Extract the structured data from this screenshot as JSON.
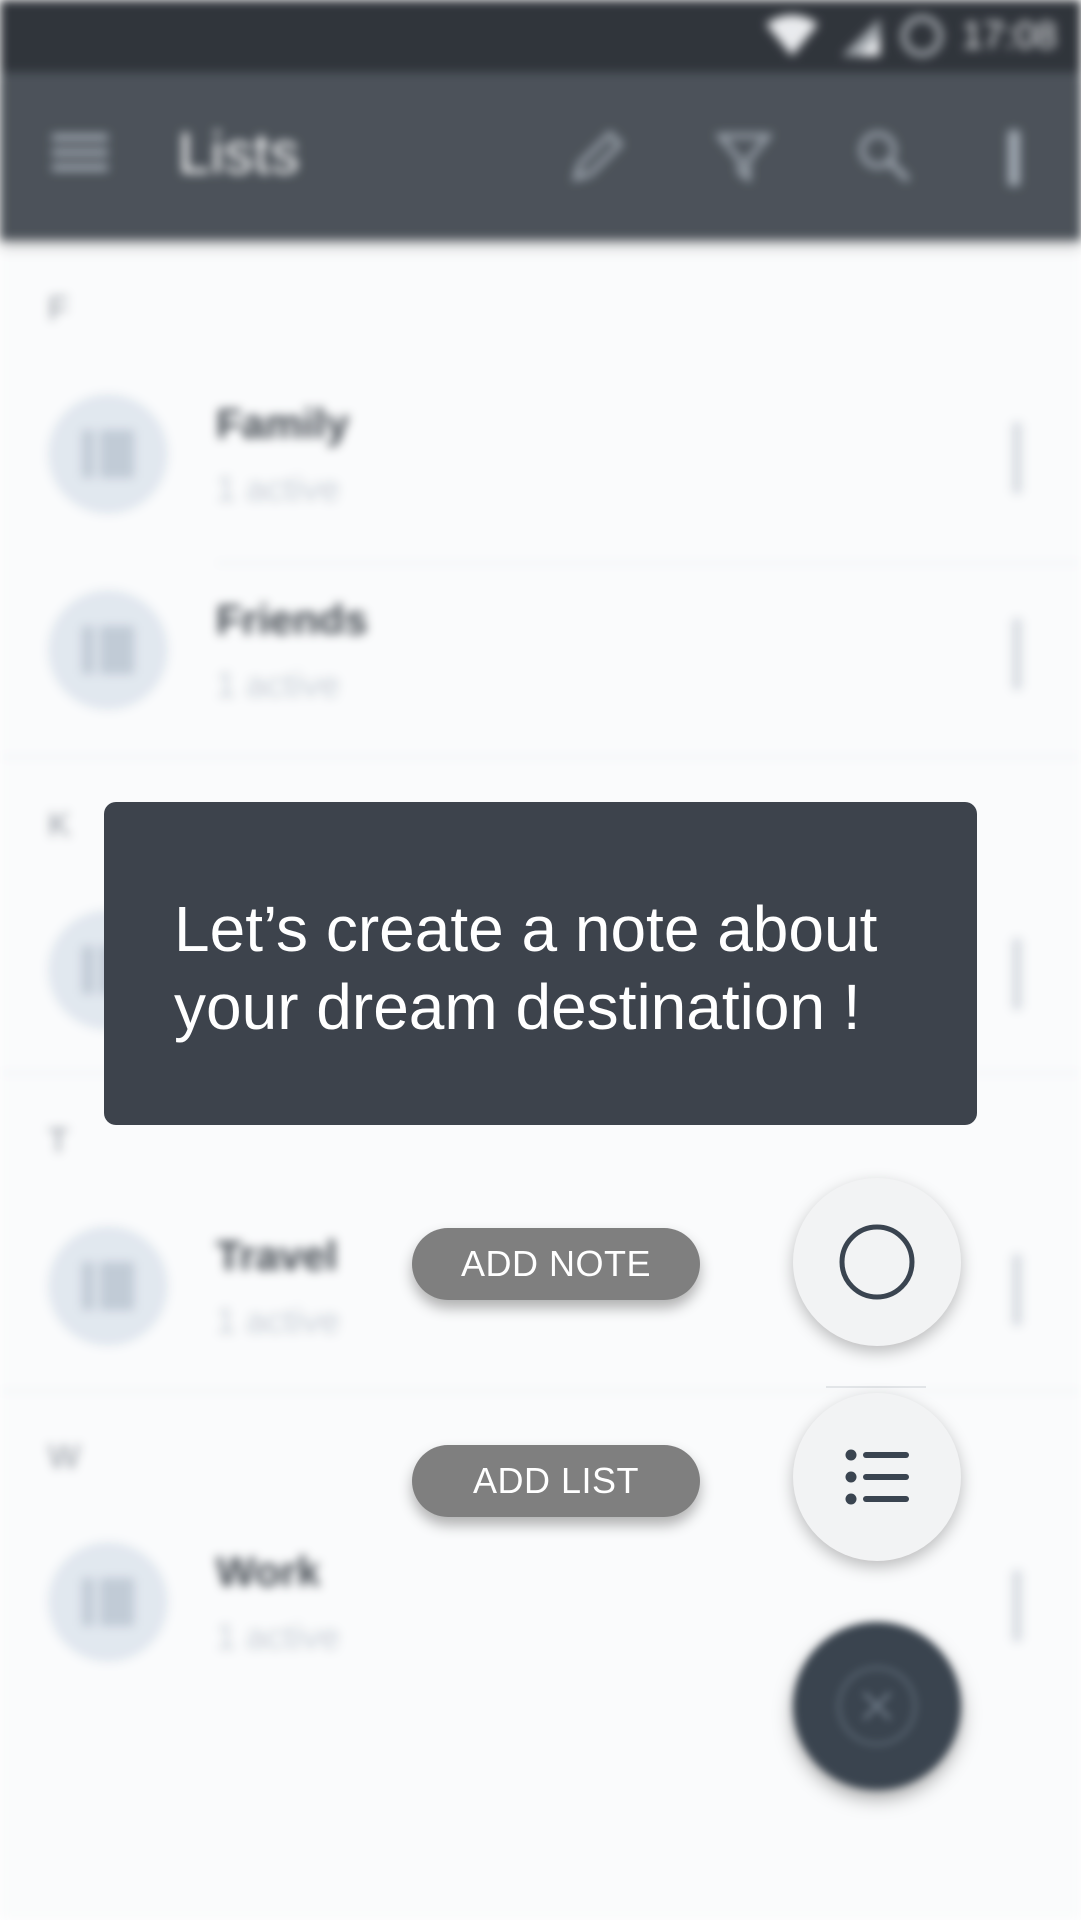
{
  "status_bar": {
    "time": "17:08",
    "icons": [
      "wifi-icon",
      "signal-icon",
      "data-saver-icon"
    ]
  },
  "app_bar": {
    "title": "Lists",
    "icons": [
      "menu-icon",
      "edit-icon",
      "filter-icon",
      "search-icon",
      "more-vert-icon"
    ]
  },
  "sections": [
    {
      "letter": "F",
      "rows": [
        {
          "name": "Family",
          "sub": "1 active"
        },
        {
          "name": "Friends",
          "sub": "1 active"
        }
      ]
    },
    {
      "letter": "K",
      "rows": [
        {
          "name": "",
          "sub": ""
        }
      ]
    },
    {
      "letter": "T",
      "rows": [
        {
          "name": "Travel",
          "sub": "1 active"
        }
      ]
    },
    {
      "letter": "W",
      "rows": [
        {
          "name": "Work",
          "sub": "1 active"
        }
      ]
    }
  ],
  "tooltip": {
    "text": "Let’s create a note about\nyour dream destination !"
  },
  "speed_dial": {
    "add_note_label": "ADD NOTE",
    "add_list_label": "ADD LIST",
    "note_icon": "circle-icon",
    "list_icon": "list-icon",
    "close_icon": "close-icon"
  },
  "colors": {
    "app_bar": "#3d444c",
    "status_bar": "#1f242b",
    "tooltip": "#3d434c",
    "pill": "#7f7f7f",
    "fab_main": "#3a444f",
    "fab_mini": "#f2f3f4"
  }
}
